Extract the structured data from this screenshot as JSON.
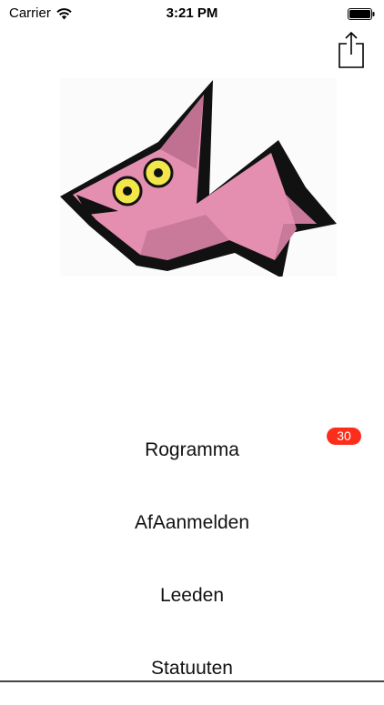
{
  "status_bar": {
    "carrier": "Carrier",
    "time": "3:21 PM",
    "icons": [
      "wifi-icon",
      "battery-icon"
    ]
  },
  "toolbar": {
    "share_icon": "share-icon"
  },
  "logo": {
    "icon": "fish-logo"
  },
  "menu": {
    "items": [
      {
        "label": "Rogramma",
        "badge": "30"
      },
      {
        "label": "AfAanmelden"
      },
      {
        "label": "Leeden"
      },
      {
        "label": "Statuuten"
      }
    ]
  },
  "colors": {
    "badge": "#fc2e1b",
    "fish_body": "#e48fb0",
    "fish_eye": "#f2e64a"
  }
}
